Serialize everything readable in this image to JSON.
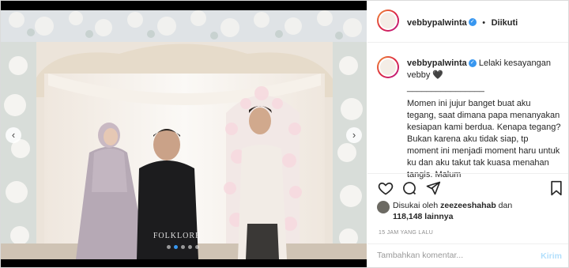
{
  "header": {
    "username": "vebbypalwinta",
    "separator": "•",
    "follow_label": "Diikuti"
  },
  "caption": {
    "username": "vebbypalwinta",
    "first_line": "Lelaki kesayangan vebby 🖤",
    "divider": "________________",
    "body": "Momen ini jujur banget buat aku tegang, saat dimana papa menanyakan kesiapan kami berdua. Kenapa tegang? Bukan karena aku tidak siap, tp moment ini menjadi moment haru untuk ku dan aku takut tak kuasa menahan tangis. Malum"
  },
  "photo": {
    "watermark": "FOLKLORE",
    "prev_arrow": "‹",
    "next_arrow": "›"
  },
  "likes": {
    "prefix": "Disukai oleh",
    "liker": "zeezeeshahab",
    "connector": "dan",
    "count": "118,148 lainnya"
  },
  "timestamp": "15 JAM YANG LALU",
  "comment": {
    "placeholder": "Tambahkan komentar...",
    "post_label": "Kirim"
  },
  "icons": {
    "like": "heart-icon",
    "comment": "comment-icon",
    "share": "share-icon",
    "save": "bookmark-icon"
  }
}
